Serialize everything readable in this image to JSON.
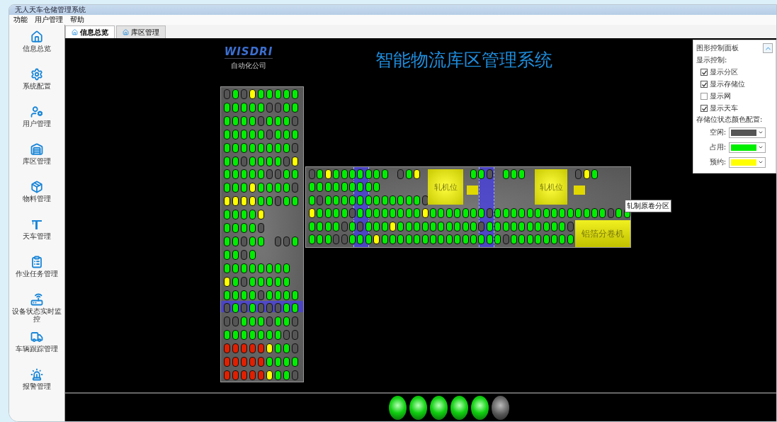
{
  "window": {
    "title": "无人天车仓储管理系统"
  },
  "menu": [
    "功能",
    "用户管理",
    "帮助"
  ],
  "tabs": [
    {
      "label": "信息总览",
      "selected": true
    },
    {
      "label": "库区管理",
      "selected": false
    }
  ],
  "sidebar": {
    "items": [
      {
        "label": "信息总览",
        "kind": "home"
      },
      {
        "label": "系统配置",
        "kind": "settings"
      },
      {
        "label": "用户管理",
        "kind": "user"
      },
      {
        "label": "库区管理",
        "kind": "warehouse"
      },
      {
        "label": "物料管理",
        "kind": "box"
      },
      {
        "label": "天车管理",
        "kind": "crane"
      },
      {
        "label": "作业任务管理",
        "kind": "tasks"
      },
      {
        "label": "设备状态实时监控",
        "kind": "router"
      },
      {
        "label": "车辆跟踪管理",
        "kind": "truck"
      },
      {
        "label": "报警管理",
        "kind": "alarm"
      }
    ]
  },
  "logo": {
    "name": "WISDRI",
    "subtitle": "自动化公司"
  },
  "title": "智能物流库区管理系统",
  "vertical_block": {
    "rows": [
      [
        {
          "kind": "free"
        },
        {
          "kind": "used"
        },
        {
          "kind": "free"
        },
        {
          "kind": "held"
        },
        {
          "kind": "used"
        },
        {
          "kind": "used"
        },
        {
          "kind": "used"
        },
        {
          "kind": "used"
        },
        {
          "kind": "used"
        }
      ],
      [
        {
          "kind": "used"
        },
        {
          "kind": "used"
        },
        {
          "kind": "used"
        },
        {
          "kind": "used"
        },
        {
          "kind": "used"
        },
        {
          "kind": "free"
        },
        {
          "kind": "free"
        },
        {
          "kind": "used"
        },
        {
          "kind": "used"
        }
      ],
      [
        {
          "kind": "used"
        },
        {
          "kind": "used"
        },
        {
          "kind": "used"
        },
        {
          "kind": "used"
        },
        {
          "kind": "free"
        },
        {
          "kind": "used"
        },
        {
          "kind": "used"
        },
        {
          "kind": "used"
        },
        {
          "kind": "free"
        }
      ],
      [
        {
          "kind": "used"
        },
        {
          "kind": "used"
        },
        {
          "kind": "used"
        },
        {
          "kind": "used"
        },
        {
          "kind": "used"
        },
        {
          "kind": "free"
        },
        {
          "kind": "used"
        },
        {
          "kind": "used"
        },
        {
          "kind": "used"
        }
      ],
      [
        {
          "kind": "used"
        },
        {
          "kind": "used"
        },
        {
          "kind": "used"
        },
        {
          "kind": "used"
        },
        {
          "kind": "used"
        },
        {
          "kind": "used"
        },
        {
          "kind": "used"
        },
        {
          "kind": "used"
        },
        {
          "kind": "free"
        }
      ],
      [
        {
          "kind": "used"
        },
        {
          "kind": "used"
        },
        {
          "kind": "free"
        },
        {
          "kind": "used"
        },
        {
          "kind": "used"
        },
        {
          "kind": "used"
        },
        {
          "kind": "used"
        },
        {
          "kind": "free"
        },
        {
          "kind": "held"
        }
      ],
      [
        {
          "kind": "used"
        },
        {
          "kind": "used"
        },
        {
          "kind": "used"
        },
        {
          "kind": "used"
        },
        {
          "kind": "used"
        },
        {
          "kind": "free"
        },
        {
          "kind": "free"
        },
        {
          "kind": "used"
        },
        {
          "kind": "used"
        }
      ],
      [
        {
          "kind": "used"
        },
        {
          "kind": "used"
        },
        {
          "kind": "used"
        },
        {
          "kind": "held"
        },
        {
          "kind": "used"
        },
        {
          "kind": "used"
        },
        {
          "kind": "used"
        },
        {
          "kind": "used"
        },
        {
          "kind": "free"
        }
      ],
      [
        {
          "kind": "held"
        },
        {
          "kind": "held"
        },
        {
          "kind": "held"
        },
        {
          "kind": "held"
        },
        {
          "kind": "used"
        },
        {
          "kind": "used"
        },
        {
          "kind": "free"
        },
        {
          "kind": "used"
        },
        {
          "kind": "used"
        }
      ],
      [
        {
          "kind": "used"
        },
        {
          "kind": "used"
        },
        {
          "kind": "used"
        },
        {
          "kind": "used"
        },
        {
          "kind": "held"
        }
      ],
      [
        {
          "kind": "used"
        },
        {
          "kind": "used"
        },
        {
          "kind": "used"
        },
        {
          "kind": "used"
        },
        {
          "kind": "free"
        }
      ],
      [
        {
          "kind": "used"
        },
        {
          "kind": "used"
        },
        {
          "kind": "free"
        },
        {
          "kind": "used"
        },
        {
          "kind": "used"
        },
        {
          "kind": "gap"
        },
        {
          "kind": "free"
        },
        {
          "kind": "free"
        },
        {
          "kind": "used"
        }
      ],
      [
        {
          "kind": "used"
        },
        {
          "kind": "used"
        },
        {
          "kind": "free"
        },
        {
          "kind": "used"
        }
      ],
      [
        {
          "kind": "used"
        },
        {
          "kind": "used"
        },
        {
          "kind": "used"
        },
        {
          "kind": "used"
        },
        {
          "kind": "used"
        },
        {
          "kind": "used"
        },
        {
          "kind": "used"
        },
        {
          "kind": "used"
        }
      ],
      [
        {
          "kind": "held"
        },
        {
          "kind": "used"
        },
        {
          "kind": "free"
        },
        {
          "kind": "used"
        },
        {
          "kind": "used"
        },
        {
          "kind": "used"
        },
        {
          "kind": "used"
        },
        {
          "kind": "used"
        }
      ],
      [
        {
          "kind": "used"
        },
        {
          "kind": "used"
        },
        {
          "kind": "used"
        },
        {
          "kind": "used"
        },
        {
          "kind": "free"
        },
        {
          "kind": "used"
        },
        {
          "kind": "used"
        },
        {
          "kind": "used"
        },
        {
          "kind": "used"
        }
      ],
      [
        {
          "kind": "free"
        },
        {
          "kind": "used"
        },
        {
          "kind": "free"
        },
        {
          "kind": "used"
        },
        {
          "kind": "free"
        },
        {
          "kind": "free"
        },
        {
          "kind": "free"
        },
        {
          "kind": "used"
        },
        {
          "kind": "used"
        }
      ],
      [
        {
          "kind": "free"
        },
        {
          "kind": "free"
        },
        {
          "kind": "used"
        },
        {
          "kind": "used"
        },
        {
          "kind": "used"
        },
        {
          "kind": "free"
        },
        {
          "kind": "used"
        },
        {
          "kind": "used"
        },
        {
          "kind": "free"
        }
      ],
      [
        {
          "kind": "used"
        },
        {
          "kind": "used"
        },
        {
          "kind": "used"
        },
        {
          "kind": "used"
        },
        {
          "kind": "used"
        },
        {
          "kind": "used"
        },
        {
          "kind": "used"
        },
        {
          "kind": "free"
        },
        {
          "kind": "free"
        }
      ],
      [
        {
          "kind": "alarm"
        },
        {
          "kind": "alarm"
        },
        {
          "kind": "alarm"
        },
        {
          "kind": "alarm"
        },
        {
          "kind": "alarm"
        },
        {
          "kind": "held"
        },
        {
          "kind": "used"
        },
        {
          "kind": "used"
        },
        {
          "kind": "free"
        }
      ],
      [
        {
          "kind": "alarm"
        },
        {
          "kind": "alarm"
        },
        {
          "kind": "alarm"
        },
        {
          "kind": "alarm"
        },
        {
          "kind": "alarm"
        },
        {
          "kind": "used"
        },
        {
          "kind": "used"
        },
        {
          "kind": "used"
        },
        {
          "kind": "used"
        }
      ],
      [
        {
          "kind": "alarm"
        },
        {
          "kind": "alarm"
        },
        {
          "kind": "alarm"
        },
        {
          "kind": "alarm"
        },
        {
          "kind": "alarm"
        },
        {
          "kind": "held"
        },
        {
          "kind": "used"
        },
        {
          "kind": "used"
        },
        {
          "kind": "free"
        }
      ]
    ]
  },
  "horizontal_block": {
    "rows": [
      [
        {
          "kind": "free"
        },
        {
          "kind": "used"
        },
        {
          "kind": "held"
        },
        {
          "kind": "used"
        },
        {
          "kind": "used"
        },
        {
          "kind": "used"
        },
        {
          "kind": "used"
        },
        {
          "kind": "used"
        },
        {
          "kind": "used"
        },
        {
          "kind": "used"
        },
        {
          "kind": "gap"
        },
        {
          "kind": "free"
        },
        {
          "kind": "used"
        },
        {
          "kind": "held"
        },
        {
          "kind": "gap"
        },
        {
          "kind": "gap"
        },
        {
          "kind": "gap"
        },
        {
          "kind": "gap"
        },
        {
          "kind": "gap"
        },
        {
          "kind": "gap"
        },
        {
          "kind": "used"
        },
        {
          "kind": "used"
        },
        {
          "kind": "free"
        },
        {
          "kind": "gap"
        },
        {
          "kind": "used"
        },
        {
          "kind": "used"
        },
        {
          "kind": "used"
        },
        {
          "kind": "gap"
        },
        {
          "kind": "gap"
        },
        {
          "kind": "gap"
        },
        {
          "kind": "gap"
        },
        {
          "kind": "gap"
        },
        {
          "kind": "gap"
        },
        {
          "kind": "free"
        },
        {
          "kind": "held"
        },
        {
          "kind": "used"
        }
      ],
      [
        {
          "kind": "used"
        },
        {
          "kind": "used"
        },
        {
          "kind": "used"
        },
        {
          "kind": "used"
        },
        {
          "kind": "used"
        },
        {
          "kind": "used"
        },
        {
          "kind": "used"
        },
        {
          "kind": "used"
        },
        {
          "kind": "used"
        }
      ],
      [
        {
          "kind": "used"
        },
        {
          "kind": "free"
        },
        {
          "kind": "used"
        },
        {
          "kind": "used"
        },
        {
          "kind": "used"
        },
        {
          "kind": "used"
        },
        {
          "kind": "used"
        },
        {
          "kind": "used"
        },
        {
          "kind": "used"
        },
        {
          "kind": "used"
        },
        {
          "kind": "used"
        },
        {
          "kind": "used"
        },
        {
          "kind": "used"
        },
        {
          "kind": "used"
        },
        {
          "kind": "free"
        }
      ],
      [
        {
          "kind": "held"
        },
        {
          "kind": "used"
        },
        {
          "kind": "used"
        },
        {
          "kind": "used"
        },
        {
          "kind": "used"
        },
        {
          "kind": "free"
        },
        {
          "kind": "used"
        },
        {
          "kind": "used"
        },
        {
          "kind": "used"
        },
        {
          "kind": "used"
        },
        {
          "kind": "used"
        },
        {
          "kind": "used"
        },
        {
          "kind": "used"
        },
        {
          "kind": "used"
        },
        {
          "kind": "held"
        },
        {
          "kind": "used"
        },
        {
          "kind": "used"
        },
        {
          "kind": "used"
        },
        {
          "kind": "used"
        },
        {
          "kind": "used"
        },
        {
          "kind": "used"
        },
        {
          "kind": "used"
        },
        {
          "kind": "free"
        },
        {
          "kind": "used"
        },
        {
          "kind": "used"
        },
        {
          "kind": "used"
        },
        {
          "kind": "used"
        },
        {
          "kind": "used"
        },
        {
          "kind": "used"
        },
        {
          "kind": "used"
        },
        {
          "kind": "used"
        },
        {
          "kind": "used"
        },
        {
          "kind": "used"
        },
        {
          "kind": "used"
        },
        {
          "kind": "used"
        },
        {
          "kind": "used"
        },
        {
          "kind": "used"
        },
        {
          "kind": "free"
        },
        {
          "kind": "used"
        },
        {
          "kind": "used"
        }
      ],
      [
        {
          "kind": "used"
        },
        {
          "kind": "used"
        },
        {
          "kind": "used"
        },
        {
          "kind": "used"
        },
        {
          "kind": "free"
        },
        {
          "kind": "used"
        },
        {
          "kind": "free"
        },
        {
          "kind": "used"
        },
        {
          "kind": "used"
        },
        {
          "kind": "used"
        },
        {
          "kind": "held"
        },
        {
          "kind": "used"
        },
        {
          "kind": "used"
        },
        {
          "kind": "used"
        },
        {
          "kind": "used"
        },
        {
          "kind": "used"
        },
        {
          "kind": "used"
        },
        {
          "kind": "used"
        },
        {
          "kind": "used"
        },
        {
          "kind": "used"
        },
        {
          "kind": "used"
        },
        {
          "kind": "free"
        },
        {
          "kind": "used"
        },
        {
          "kind": "used"
        },
        {
          "kind": "used"
        },
        {
          "kind": "used"
        },
        {
          "kind": "used"
        },
        {
          "kind": "used"
        },
        {
          "kind": "used"
        },
        {
          "kind": "used"
        },
        {
          "kind": "used"
        },
        {
          "kind": "used"
        },
        {
          "kind": "free"
        }
      ],
      [
        {
          "kind": "used"
        },
        {
          "kind": "used"
        },
        {
          "kind": "used"
        },
        {
          "kind": "free"
        },
        {
          "kind": "free"
        },
        {
          "kind": "used"
        },
        {
          "kind": "used"
        },
        {
          "kind": "used"
        },
        {
          "kind": "held"
        },
        {
          "kind": "used"
        },
        {
          "kind": "used"
        },
        {
          "kind": "used"
        },
        {
          "kind": "used"
        },
        {
          "kind": "used"
        },
        {
          "kind": "used"
        },
        {
          "kind": "used"
        },
        {
          "kind": "used"
        },
        {
          "kind": "used"
        },
        {
          "kind": "used"
        },
        {
          "kind": "used"
        },
        {
          "kind": "used"
        },
        {
          "kind": "used"
        },
        {
          "kind": "used"
        },
        {
          "kind": "used"
        },
        {
          "kind": "free"
        },
        {
          "kind": "used"
        },
        {
          "kind": "used"
        },
        {
          "kind": "used"
        },
        {
          "kind": "used"
        },
        {
          "kind": "used"
        },
        {
          "kind": "used"
        },
        {
          "kind": "used"
        },
        {
          "kind": "used"
        }
      ]
    ]
  },
  "machines": [
    {
      "label": "轧机位",
      "kind": "mill"
    },
    {
      "label": "轧机位",
      "kind": "mill"
    },
    {
      "label": "铝箔分卷机",
      "kind": "slitter"
    }
  ],
  "tooltip": "轧制原卷分区",
  "panel": {
    "title": "图形控制面板",
    "display_heading": "显示控制:",
    "toggles": [
      {
        "label": "显示分区",
        "kind": "zones",
        "checked": true
      },
      {
        "label": "显示存储位",
        "kind": "slots",
        "checked": true
      },
      {
        "label": "显示网",
        "kind": "grid",
        "checked": false
      },
      {
        "label": "显示天车",
        "kind": "cranes",
        "checked": true
      }
    ],
    "color_heading": "存储位状态颜色配置:",
    "legend": [
      {
        "label": "空闲:",
        "color": "#555555"
      },
      {
        "label": "占用:",
        "color": "#00ee00"
      },
      {
        "label": "预约:",
        "color": "#ffff00"
      }
    ]
  },
  "lights": [
    {
      "on": true
    },
    {
      "on": true
    },
    {
      "on": true
    },
    {
      "on": true
    },
    {
      "on": true
    },
    {
      "on": false
    }
  ]
}
